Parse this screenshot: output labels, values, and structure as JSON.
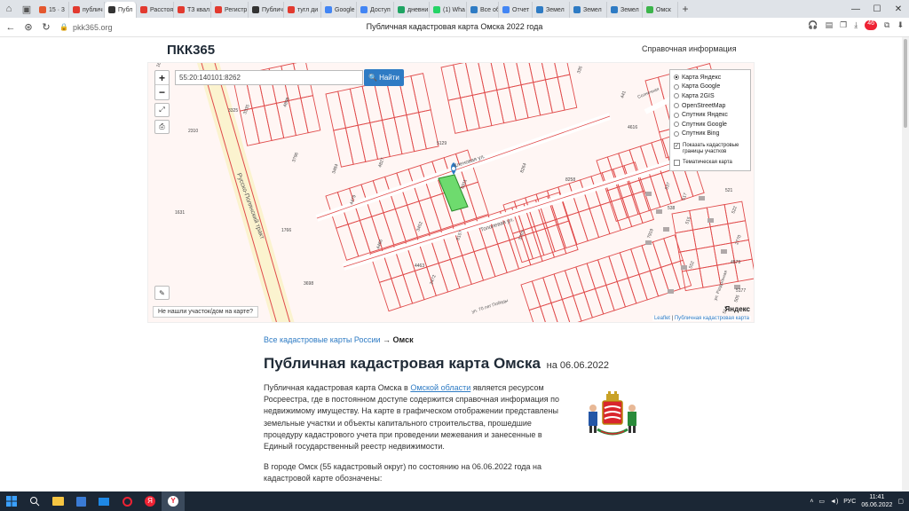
{
  "browser": {
    "tabs": [
      {
        "label": "15 · 3",
        "color": "#e4572e"
      },
      {
        "label": "публич",
        "color": "#e23a2f"
      },
      {
        "label": "Публ",
        "color": "#333333",
        "active": true
      },
      {
        "label": "Расстоя",
        "color": "#e23a2f"
      },
      {
        "label": "ТЗ квал",
        "color": "#e23a2f"
      },
      {
        "label": "Регистр",
        "color": "#e23a2f"
      },
      {
        "label": "Публич",
        "color": "#333333"
      },
      {
        "label": "тугл ди",
        "color": "#e23a2f"
      },
      {
        "label": "Google",
        "color": "#4285f4"
      },
      {
        "label": "Доступ",
        "color": "#4285f4"
      },
      {
        "label": "дневни",
        "color": "#1fa463"
      },
      {
        "label": "(1) Wha",
        "color": "#25d366"
      },
      {
        "label": "Все об",
        "color": "#2e7bc4"
      },
      {
        "label": "Отчет",
        "color": "#4285f4"
      },
      {
        "label": "Земел",
        "color": "#2e7bc4"
      },
      {
        "label": "Земел",
        "color": "#2e7bc4"
      },
      {
        "label": "Земел",
        "color": "#2e7bc4"
      },
      {
        "label": "Омск",
        "color": "#3cb44b"
      }
    ],
    "url": "pkk365.org",
    "page_title": "Публичная кадастровая карта Омска 2022 года"
  },
  "site": {
    "logo": "ПКК365",
    "help_link": "Справочная информация"
  },
  "map": {
    "search_value": "55:20:140101:8262",
    "find_label": "Найти",
    "layers": [
      "Карта Яндекс",
      "Карта Google",
      "Карта 2GIS",
      "OpenStreetMap",
      "Спутник Яндекс",
      "Спутник Google",
      "Спутник Bing"
    ],
    "selected_layer": "Карта Яндекс",
    "option_show_borders": "Показать кадастровые границы участков",
    "option_thematic": "Тематическая карта",
    "not_found": "Не нашли участок/дом на карте?",
    "attribution_leaflet": "Leaflet",
    "attribution_pkk": "Публичная кадастровая карта",
    "yandex_logo": "Яндекс",
    "roads": [
      "Русско-Полянский тракт",
      "Кленовая ул.",
      "Тополевая ул.",
      "Солнечная",
      "ул. Раздольная",
      "ул. 70 лет Победы"
    ],
    "parcel_labels": [
      "1631",
      "335",
      "441",
      "4616",
      "4617",
      "8264",
      "8258",
      "6911",
      "4479",
      "2310",
      "537",
      "517",
      "521",
      "522",
      "515",
      "538",
      "7919",
      "552",
      "4579",
      "505",
      "514",
      "5177",
      "2770",
      "1602",
      "3325",
      "3335",
      "4898",
      "5129",
      "4827",
      "3796",
      "3698",
      "3484",
      "4466",
      "4463",
      "2472",
      "3452",
      "1766",
      "8157",
      "3703"
    ]
  },
  "content": {
    "breadcrumb_link": "Все кадастровые карты России",
    "breadcrumb_arrow": "→",
    "breadcrumb_current": "Омск",
    "heading": "Публичная кадастровая карта Омска",
    "heading_date": "на 06.06.2022",
    "p1_before": "Публичная кадастровая карта Омска в ",
    "p1_link": "Омской области",
    "p1_after": " является ресурсом Росреестра, где в постоянном доступе содержится справочная информация по недвижимому имуществу. На карте в графическом отображении представлены земельные участки и объекты капитального строительства, прошедшие процедуру кадастрового учета при проведении межевания и занесенные в Единый государственный реестр недвижимости.",
    "p2": "В городе Омск (55 кадастровый округ) по состоянию на 06.06.2022 года на кадастровой карте обозначены:"
  },
  "taskbar": {
    "lang": "РУС",
    "time": "11:41",
    "date": "06.06.2022"
  }
}
